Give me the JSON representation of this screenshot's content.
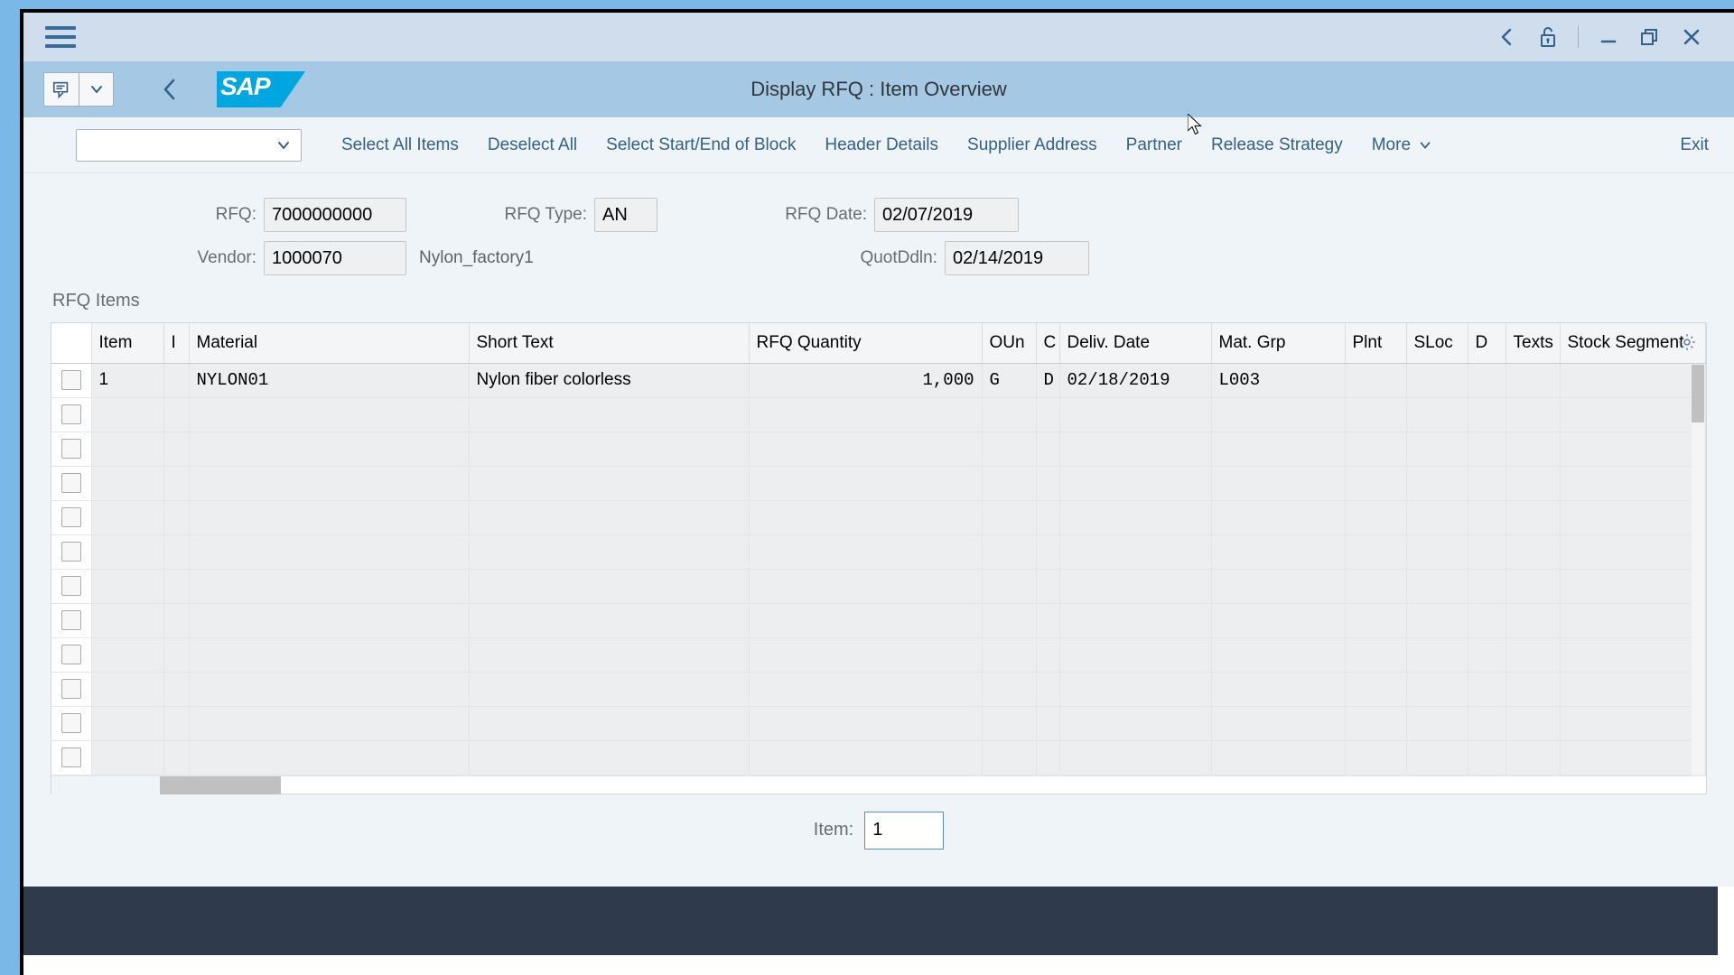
{
  "window": {
    "controls": [
      {
        "name": "nav-back",
        "icon": "chevron-left-icon"
      },
      {
        "name": "lock",
        "icon": "unlock-icon"
      },
      {
        "name": "minimize",
        "icon": "minimize-icon"
      },
      {
        "name": "restore",
        "icon": "restore-icon"
      },
      {
        "name": "close",
        "icon": "close-icon"
      }
    ]
  },
  "shell": {
    "logo_text": "SAP",
    "title": "Display RFQ : Item Overview",
    "menu_icon": "note-icon",
    "dropdown_icon": "chevron-down-icon",
    "back_icon": "chevron-left-icon"
  },
  "toolbar": {
    "select_value": "",
    "select_placeholder": "",
    "actions": [
      {
        "label": "Select All Items",
        "name": "select-all-items-button"
      },
      {
        "label": "Deselect All",
        "name": "deselect-all-button"
      },
      {
        "label": "Select Start/End of Block",
        "name": "select-block-button"
      },
      {
        "label": "Header Details",
        "name": "header-details-button"
      },
      {
        "label": "Supplier Address",
        "name": "supplier-address-button"
      },
      {
        "label": "Partner",
        "name": "partner-button"
      },
      {
        "label": "Release Strategy",
        "name": "release-strategy-button"
      },
      {
        "label": "More",
        "name": "more-button",
        "has_chevron": true
      }
    ],
    "exit_label": "Exit"
  },
  "form": {
    "rfq_label": "RFQ:",
    "rfq_value": "7000000000",
    "rfq_type_label": "RFQ Type:",
    "rfq_type_value": "AN",
    "rfq_date_label": "RFQ Date:",
    "rfq_date_value": "02/07/2019",
    "vendor_label": "Vendor:",
    "vendor_value": "1000070",
    "vendor_name": "Nylon_factory1",
    "quot_deadline_label": "QuotDdln:",
    "quot_deadline_value": "02/14/2019"
  },
  "table": {
    "title": "RFQ Items",
    "settings_icon": "gear-icon",
    "columns": [
      {
        "key": "check",
        "label": ""
      },
      {
        "key": "item",
        "label": "Item"
      },
      {
        "key": "i",
        "label": "I"
      },
      {
        "key": "material",
        "label": "Material"
      },
      {
        "key": "short_text",
        "label": "Short Text"
      },
      {
        "key": "rfq_quantity",
        "label": "RFQ Quantity"
      },
      {
        "key": "oun",
        "label": "OUn"
      },
      {
        "key": "c",
        "label": "C"
      },
      {
        "key": "deliv_date",
        "label": "Deliv. Date"
      },
      {
        "key": "mat_grp",
        "label": "Mat. Grp"
      },
      {
        "key": "plnt",
        "label": "Plnt"
      },
      {
        "key": "sloc",
        "label": "SLoc"
      },
      {
        "key": "d",
        "label": "D"
      },
      {
        "key": "texts",
        "label": "Texts"
      },
      {
        "key": "stock_segment",
        "label": "Stock Segment"
      }
    ],
    "rows": [
      {
        "item": "1",
        "i": "",
        "material": "NYLON01",
        "short_text": "Nylon fiber colorless",
        "rfq_quantity": "1,000",
        "oun": "G",
        "c": "D",
        "deliv_date": "02/18/2019",
        "mat_grp": "L003",
        "plnt": "",
        "sloc": "",
        "d": "",
        "texts": "",
        "stock_segment": ""
      }
    ],
    "empty_row_count": 11
  },
  "footer": {
    "item_label": "Item:",
    "item_value": "1"
  }
}
